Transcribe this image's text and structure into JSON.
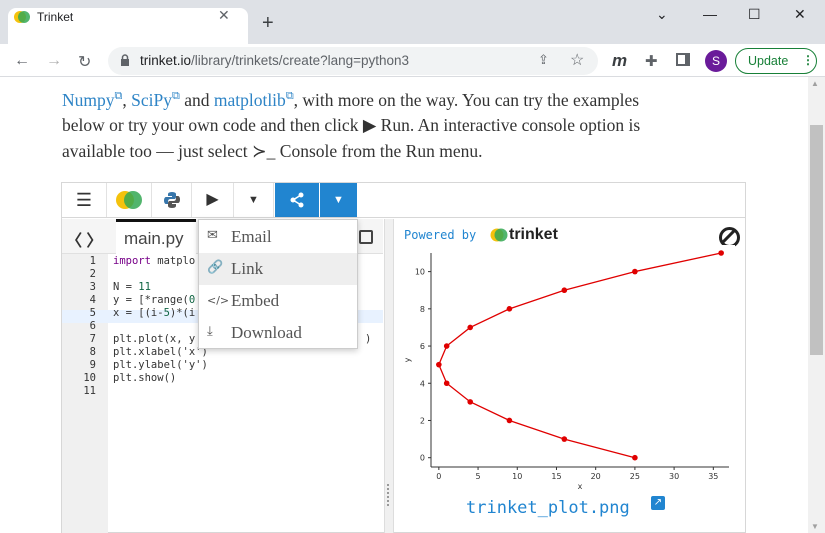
{
  "browser": {
    "tab_title": "Trinket",
    "tab_close": "✕",
    "new_tab": "+",
    "window": {
      "minimize": "⌄",
      "restore": "—",
      "maximize": "☐",
      "close": "✕"
    },
    "url_host": "trinket.io",
    "url_path": "/library/trinkets/create?lang=python3",
    "avatar": "S",
    "update_label": "Update"
  },
  "intro": {
    "link_numpy": "Numpy",
    "link_scipy": "SciPy",
    "and": " and ",
    "link_matplotlib": "matplotlib",
    "line1_tail": ", with more on the way. You can try the examples",
    "line2": "below or try your own code and then click ▶ Run. An interactive console option is",
    "line3": "available too — just select  ≻_ Console from the Run menu."
  },
  "editor": {
    "file_name": "main.py",
    "line_numbers": [
      "1",
      "2",
      "3",
      "4",
      "5",
      "6",
      "7",
      "8",
      "9",
      "10",
      "11"
    ],
    "lines": [
      "import matplo",
      "",
      "N = 11",
      "y = [*range(0",
      "x = [(i-5)*(i",
      "",
      "plt.plot(x, y",
      "plt.xlabel('x')",
      "plt.ylabel('y')",
      "plt.show()",
      ""
    ],
    "line7_tail": ")"
  },
  "share_menu": {
    "items": [
      {
        "label": "Email",
        "icon": "envelope-icon"
      },
      {
        "label": "Link",
        "icon": "link-icon"
      },
      {
        "label": "Embed",
        "icon": "code-icon"
      },
      {
        "label": "Download",
        "icon": "download-icon"
      }
    ]
  },
  "output": {
    "powered_by": "Powered by",
    "brand": "trinket",
    "plot_file": "trinket_plot.png"
  },
  "colors": {
    "accent": "#2185d0",
    "plot_line": "#e00000"
  },
  "chart_data": {
    "type": "line",
    "xlabel": "x",
    "ylabel": "y",
    "xlim": [
      -1,
      37
    ],
    "ylim": [
      -0.5,
      11
    ],
    "xticks": [
      0,
      5,
      10,
      15,
      20,
      25,
      30,
      35
    ],
    "yticks": [
      0,
      2,
      4,
      6,
      8,
      10
    ],
    "series": [
      {
        "x": [
          25,
          16,
          9,
          4,
          1,
          0,
          1,
          4,
          9,
          16,
          25,
          36
        ],
        "y": [
          0,
          1,
          2,
          3,
          4,
          5,
          6,
          7,
          8,
          9,
          10,
          11
        ]
      }
    ]
  }
}
